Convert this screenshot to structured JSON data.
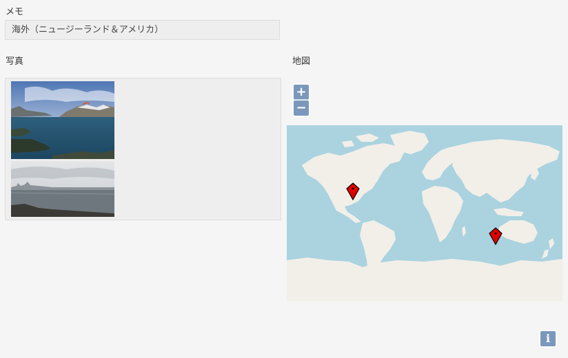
{
  "memo": {
    "label": "メモ",
    "value": "海外（ニュージーランド＆アメリカ）"
  },
  "photos": {
    "label": "写真",
    "items": [
      {
        "name": "lake-mountain-photo"
      },
      {
        "name": "bay-city-photo"
      }
    ]
  },
  "map": {
    "label": "地図",
    "zoom_in_label": "+",
    "zoom_out_label": "−",
    "info_label": "i",
    "colors": {
      "water": "#aad3df",
      "land": "#f2efe9",
      "marker": "#e00000",
      "control": "#7b98bc"
    },
    "markers": [
      {
        "place": "west-coast-usa"
      },
      {
        "place": "new-zealand"
      }
    ]
  }
}
